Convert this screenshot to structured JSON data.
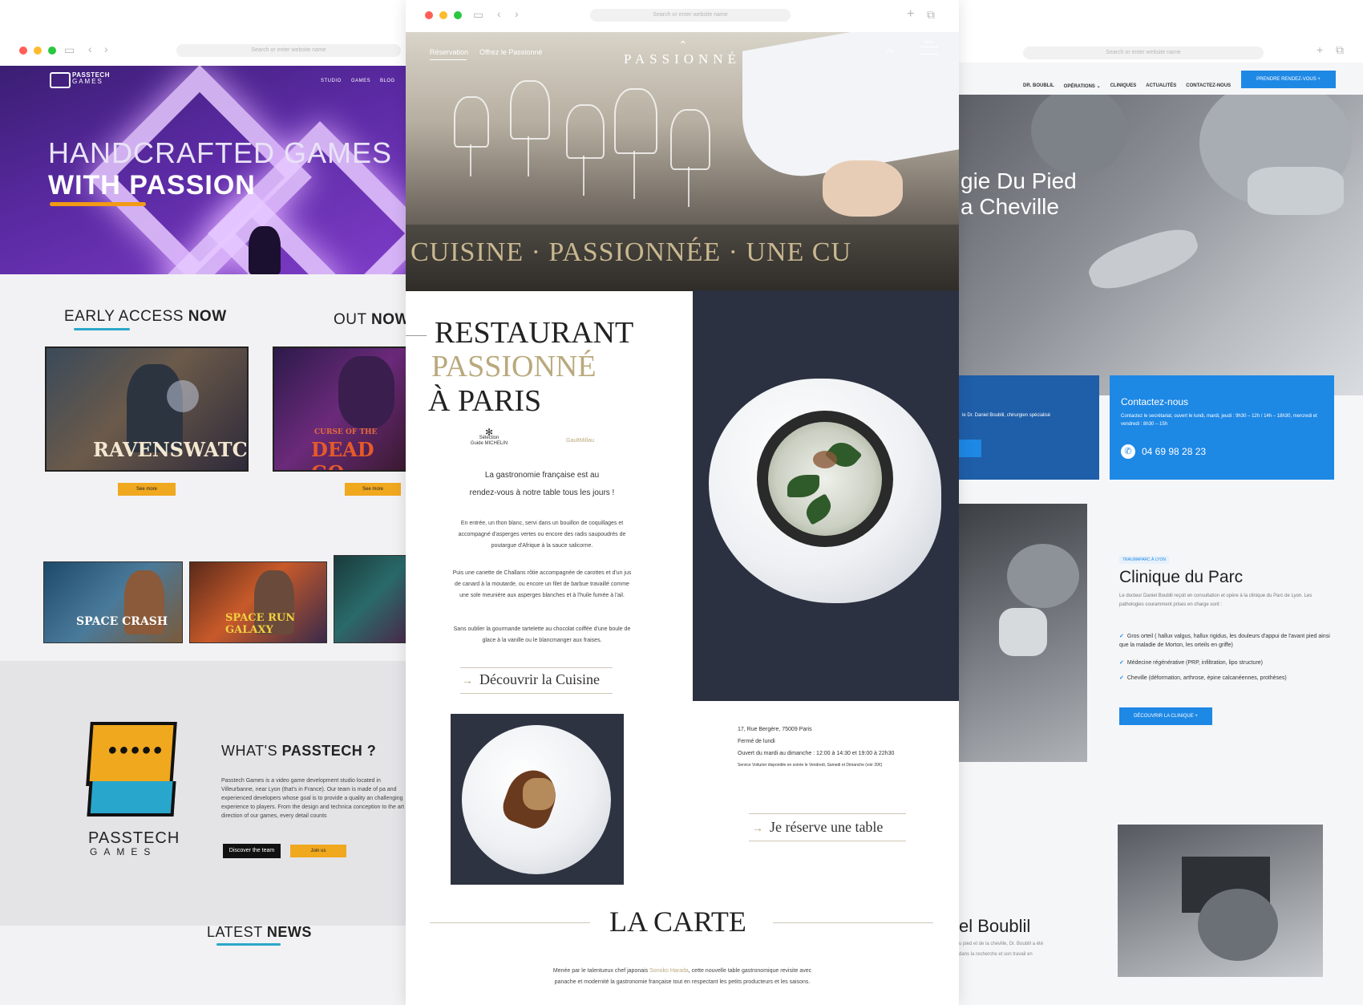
{
  "left": {
    "url": "Search or enter website name",
    "brand": [
      "PASSTECH",
      "GAMES"
    ],
    "nav": [
      "STUDIO",
      "GAMES",
      "BLOG"
    ],
    "hero_line1": "HANDCRAFTED GAMES",
    "hero_line2": "WITH PASSION",
    "early_access": {
      "label": "EARLY ACCESS",
      "bold": "NOW"
    },
    "out_now": {
      "label": "OUT",
      "bold": "NOW"
    },
    "game1": "RAVENSWATCH",
    "game2": "DEAD",
    "game2_sub": "CURSE OF THE",
    "game2_tail": "GO",
    "see_more": "See more",
    "thumbs": [
      "SPACE CRASH",
      "SPACE RUN GALAXY"
    ],
    "what_title": {
      "label": "WHAT'S",
      "bold": "PASSTECH ?"
    },
    "what_text": "Passtech Games is a video game development studio located in Villeurbanne, near Lyon (that's in France). Our team is made of pa and experienced developers whose goal is to provide a quality an challenging experience to players. From the design and technica conception to the art direction of our games, every detail counts",
    "btn_team": "Discover the team",
    "btn_join": "Join us",
    "logo_word": "PASSTECH",
    "logo_sub": "GAMES",
    "latest": {
      "label": "LATEST",
      "bold": "NEWS"
    }
  },
  "center": {
    "url": "Search or enter website name",
    "nav_left": [
      "Réservation",
      "Offrez le Passionné"
    ],
    "logo": "PASSIONNÉ",
    "lang": "FR",
    "menu": "Menu",
    "hero_text": "CUISINE · PASSIONNÉE · UNE CU",
    "title1": "RESTAURANT",
    "title2": "PASSIONNÉ",
    "title3": "À PARIS",
    "michelin": [
      "Sélection",
      "Guide MICHELIN"
    ],
    "gault": "GaultMillau",
    "intro1": "La gastronomie française est au",
    "intro2": "rendez-vous à notre table tous les jours !",
    "p1": "En entrée, un thon blanc, servi dans un bouillon de coquillages et accompagné d'asperges vertes ou encore des radis saupoudrés de poutargue d'Afrique à la sauce salicorne.",
    "p2": "Puis une canette de Challans rôtie accompagnée de carottes et d'un jus de canard à la moutarde, ou encore un filet de barbue travaillé comme une sole meunière aux asperges blanches et à l'huile fumée à l'ail.",
    "p3": "Sans oublier la gourmande tartelette au chocolat coiffée d'une boule de glace à la vanille ou le blancmanger aux fraises.",
    "cta1": "Découvrir la Cuisine",
    "address": "17, Rue Bergère, 75009 Paris",
    "closed": "Fermé de lundi",
    "hours": "Ouvert du mardi au dimanche : 12:00 à 14:30 et 19:00 à 22h30",
    "service": "Service Voiturier disponible en soirée le Vendredi, Samedi et Dimanche (voir 20€)",
    "cta2": "Je réserve une table",
    "carte": "LA CARTE",
    "carte_text1": "Menée par le talentueux chef japonais",
    "carte_chef": "Sonoko Harada",
    "carte_text1b": ", cette nouvelle table gastronomique revisite avec",
    "carte_text2": "panache et modernité la gastronomie française tout en respectant les petits producteurs et les saisons."
  },
  "right": {
    "url": "Search or enter website name",
    "nav": [
      "DR. BOUBLIL",
      "OPÉRATIONS ⌄",
      "CLINIQUES",
      "ACTUALITÉS",
      "CONTACTEZ-NOUS"
    ],
    "cta": "PRENDRE RENDEZ-VOUS +",
    "hero1": "gie Du Pied",
    "hero2": "a Cheville",
    "box1_text": "le Dr. Daniel Boublil, chirurgien spécialisé",
    "contact_title": "Contactez-nous",
    "contact_text": "Contactez le secrétariat, ouvert le lundi, mardi, jeudi : 9h30 – 12h / 14h – 18h30, mercredi et vendredi : 8h30 – 15h",
    "phone": "04 69 98 28 23",
    "tag": "TRAUMAPARC À LYON",
    "clinic_title": "Clinique du Parc",
    "clinic_text": "Le docteur Daniel Boublil reçoit en consultation et opère à la clinique du Parc de Lyon. Les pathologies couramment prises en charge sont :",
    "bullets": [
      "Gros orteil ( hallux valgus, hallux rigidus, les douleurs d'appui de l'avant pied ainsi que la maladie de Morton, les orteils en griffe)",
      "Médecine régénérative (PRP, infiltration, lipo structure)",
      "Cheville (déformation, arthrose, épine calcanéennes, prothèses)"
    ],
    "clinic_btn": "DÉCOUVRIR LA CLINIQUE +",
    "bottom_title": "el Boublil",
    "bottom_text1": "u pied et de la cheville, Dr. Boublil a été",
    "bottom_text2": "dans la recherche et son travail en"
  },
  "colors": {
    "orange": "#f0a81f",
    "teal": "#2aa7c9",
    "blue": "#1e88e5",
    "navy": "#1f5ea8",
    "gold": "#b9a97c"
  }
}
